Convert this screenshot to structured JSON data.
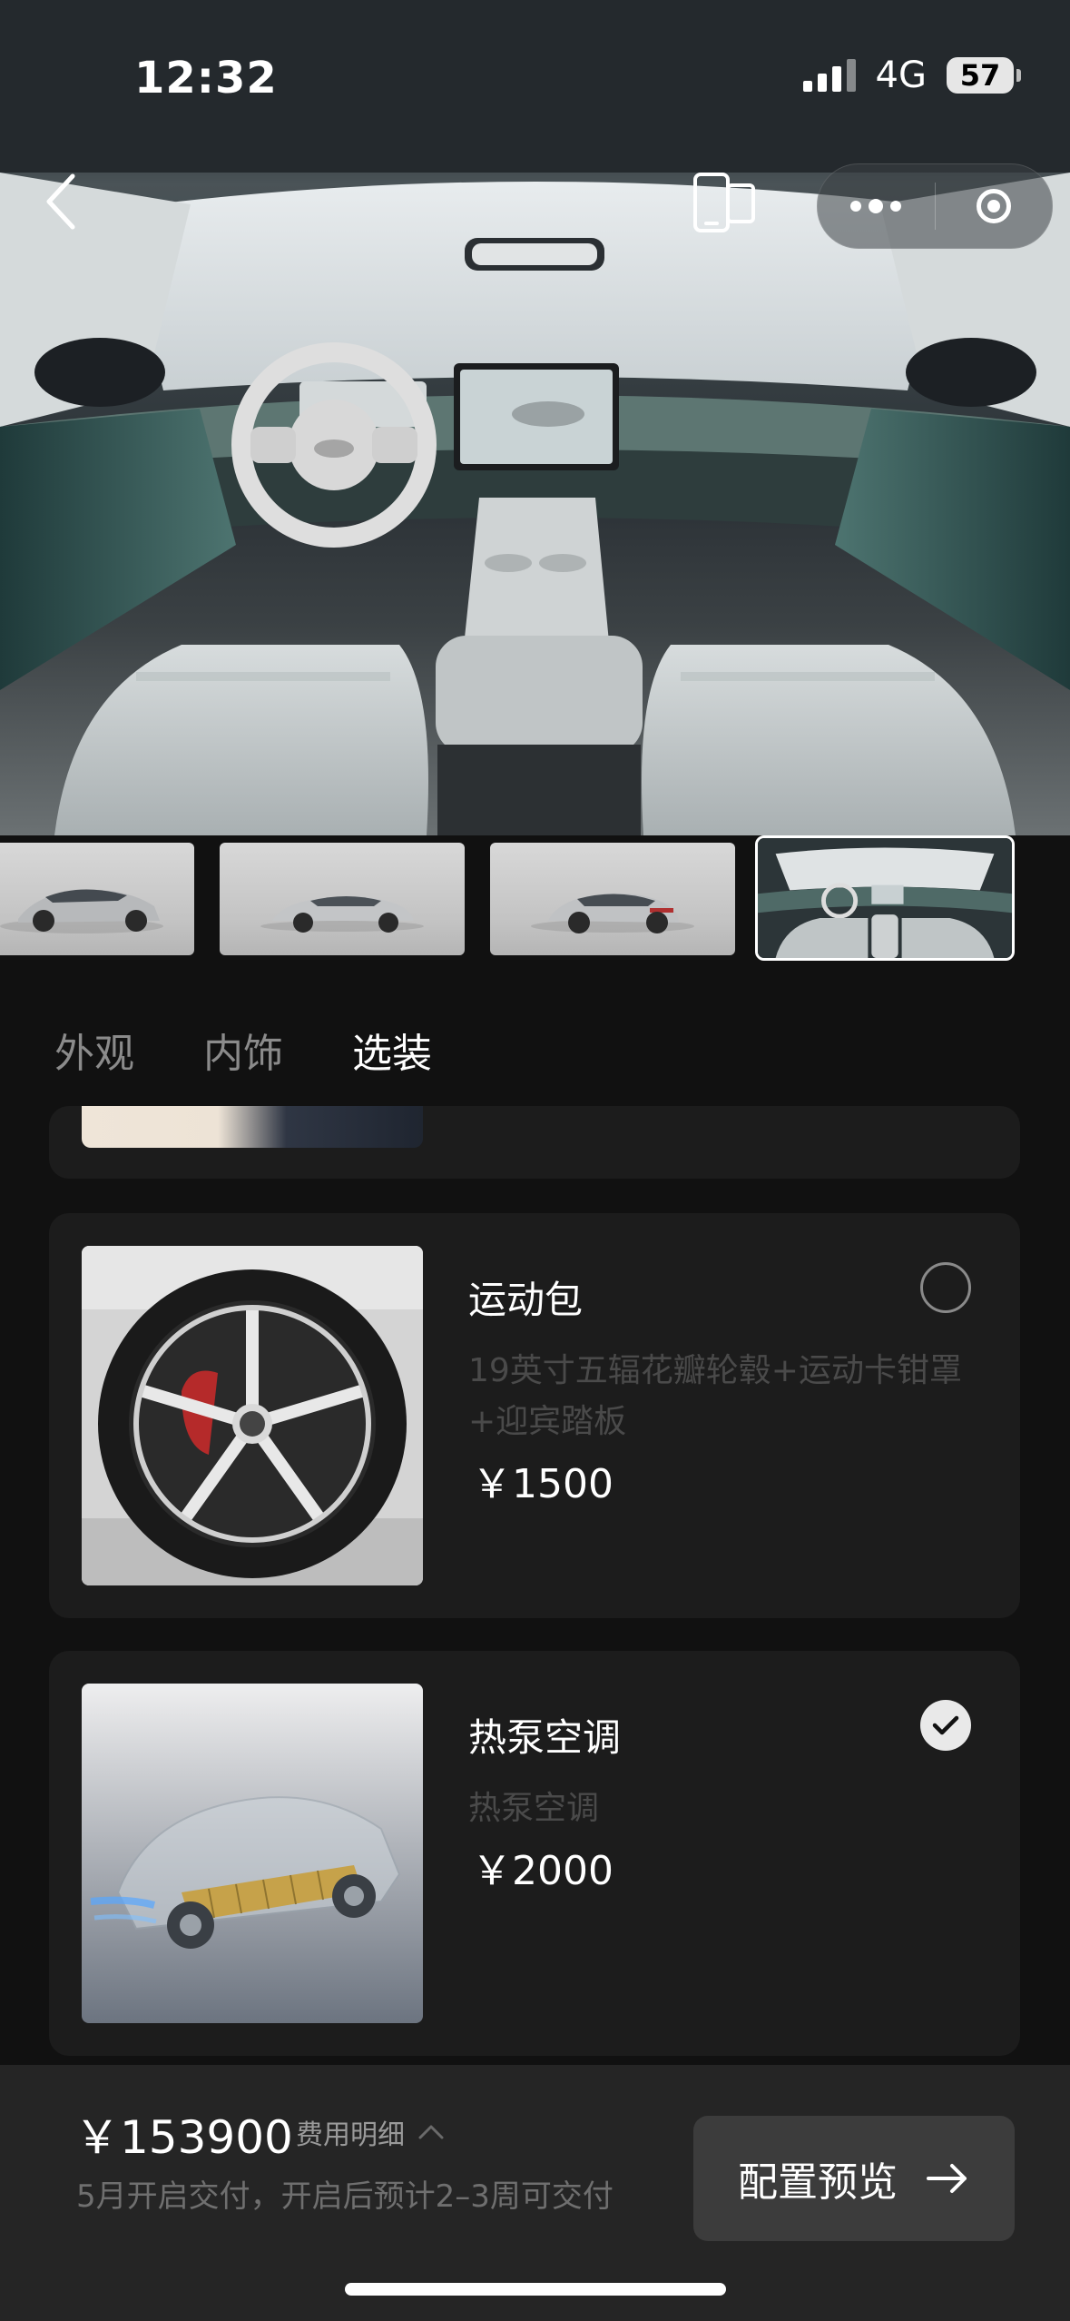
{
  "status_bar": {
    "time": "12:32",
    "network": "4G",
    "battery": "57"
  },
  "hero": {
    "image": "car-interior-dashboard-photo"
  },
  "gallery": {
    "items": [
      {
        "label": "exterior-front-three-quarter",
        "selected": false
      },
      {
        "label": "exterior-side",
        "selected": false
      },
      {
        "label": "exterior-rear-three-quarter",
        "selected": false
      },
      {
        "label": "interior",
        "selected": true
      }
    ]
  },
  "tabs": [
    {
      "label": "外观",
      "active": false
    },
    {
      "label": "内饰",
      "active": false
    },
    {
      "label": "选装",
      "active": true
    }
  ],
  "options": [
    {
      "title": "运动包",
      "description": "19英寸五辐花瓣轮毂+运动卡钳罩+迎宾踏板",
      "price": "￥1500",
      "selected": false,
      "image": "wheel-with-red-caliper"
    },
    {
      "title": "热泵空调",
      "description": "热泵空调",
      "price": "￥2000",
      "selected": true,
      "image": "car-chassis-battery-xray"
    }
  ],
  "bottom_bar": {
    "total_price": "￥153900",
    "detail_label": "费用明细",
    "delivery_note": "5月开启交付，开启后预计2–3周可交付",
    "preview_button": "配置预览"
  },
  "colors": {
    "background": "#111111",
    "card": "#1c1c1c",
    "bottom_bar": "#252525",
    "button": "#3c3c3c"
  }
}
